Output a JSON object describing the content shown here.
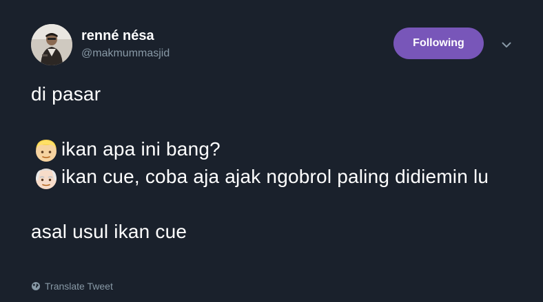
{
  "author": {
    "display_name": "renné nésa",
    "handle": "@makmummasjid",
    "avatar_icon": "profile-photo"
  },
  "follow_button": {
    "label": "Following",
    "color": "#7856b9"
  },
  "caret_icon": "chevron-down-icon",
  "tweet": {
    "line1": "di pasar",
    "line2_emoji": "blond-person-emoji",
    "line2_text": "ikan apa ini bang?",
    "line3_emoji": "old-man-emoji",
    "line3_text": "ikan cue, coba aja ajak ngobrol paling didiemin lu",
    "line4": "asal usul ikan cue"
  },
  "translate": {
    "label": "Translate Tweet",
    "icon": "globe-icon"
  },
  "colors": {
    "background": "#1a212c",
    "text": "#ffffff",
    "muted": "#8899a6"
  }
}
